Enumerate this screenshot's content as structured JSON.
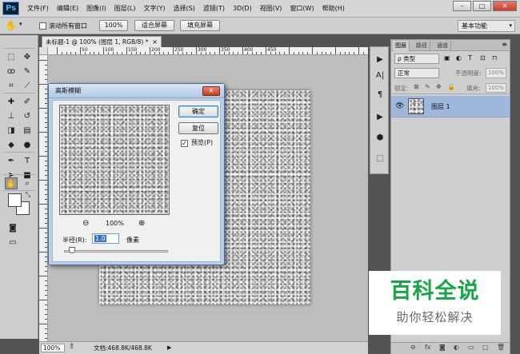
{
  "app": {
    "logo": "Ps"
  },
  "menu": [
    "文件(F)",
    "编辑(E)",
    "图像(I)",
    "图层(L)",
    "文字(Y)",
    "选择(S)",
    "滤镜(T)",
    "3D(D)",
    "视图(V)",
    "窗口(W)",
    "帮助(H)"
  ],
  "window_controls": {
    "minimize": "–",
    "maximize": "□",
    "close": "✕"
  },
  "options_bar": {
    "tool_icon": "hand-icon",
    "scroll_all_label": "滚动所有窗口",
    "zoom_100": "100%",
    "fit_screen": "适合屏幕",
    "fill_screen": "填充屏幕",
    "workspace": "基本功能"
  },
  "tools": [
    {
      "name": "rectangular-marquee-icon",
      "glyph": "⬚"
    },
    {
      "name": "move-icon",
      "glyph": "✥"
    },
    {
      "name": "lasso-icon",
      "glyph": "ꝏ"
    },
    {
      "name": "quick-select-icon",
      "glyph": "✎"
    },
    {
      "name": "crop-icon",
      "glyph": "⌗"
    },
    {
      "name": "eyedropper-icon",
      "glyph": "⟋"
    },
    {
      "name": "healing-brush-icon",
      "glyph": "✚"
    },
    {
      "name": "brush-icon",
      "glyph": "✐"
    },
    {
      "name": "clone-stamp-icon",
      "glyph": "⊥"
    },
    {
      "name": "history-brush-icon",
      "glyph": "↺"
    },
    {
      "name": "eraser-icon",
      "glyph": "◨"
    },
    {
      "name": "gradient-icon",
      "glyph": "▤"
    },
    {
      "name": "blur-icon",
      "glyph": "◆"
    },
    {
      "name": "dodge-icon",
      "glyph": "●"
    },
    {
      "name": "pen-icon",
      "glyph": "✒"
    },
    {
      "name": "type-icon",
      "glyph": "T"
    },
    {
      "name": "path-select-icon",
      "glyph": "➤"
    },
    {
      "name": "rectangle-shape-icon",
      "glyph": "■"
    },
    {
      "name": "hand-icon",
      "glyph": "✋"
    },
    {
      "name": "zoom-icon",
      "glyph": "⌕"
    }
  ],
  "document": {
    "tab_title": "未标题-1 @ 100% (图层 1, RGB/8) *",
    "tab_close": "×",
    "ruler_labels": [
      "50",
      "100",
      "150",
      "200",
      "250",
      "300",
      "350",
      "400",
      "450"
    ],
    "zoom": "100%",
    "doc_info": "文档:468.8K/468.8K",
    "status_arrow": "▶"
  },
  "dialog": {
    "title": "高斯模糊",
    "close": "✕",
    "ok": "确定",
    "reset": "复位",
    "preview_check": "✓",
    "preview_label": "预览(P)",
    "zoom_level": "100%",
    "radius_label": "半径(R):",
    "radius_value": "1.0",
    "radius_unit": "像素",
    "radius_slider": 0.08
  },
  "strip_icons": [
    "▶",
    "A|",
    "¶",
    "▶",
    "⬢",
    "⬚"
  ],
  "layers": {
    "tabs": [
      "图层",
      "路径",
      "通道"
    ],
    "menu": "≡",
    "filter": "ρ 类型",
    "filter_icons": [
      "▣",
      "◐",
      "T",
      "⊡",
      "⊓"
    ],
    "blend_mode": "正常",
    "opacity_label": "不透明度:",
    "opacity": "100%",
    "lock_label": "锁定:",
    "lock_icons": [
      "⊠",
      "✎",
      "✥",
      "🔒"
    ],
    "fill_label": "填充:",
    "fill": "100%",
    "layer_name": "图层 1",
    "eye": "👁",
    "bottom_icons": [
      "⊖",
      "fx",
      "◙",
      "◐",
      "▭",
      "▢",
      "🗑"
    ]
  },
  "watermark": {
    "title": "百科全说",
    "subtitle": "助你轻松解决"
  }
}
